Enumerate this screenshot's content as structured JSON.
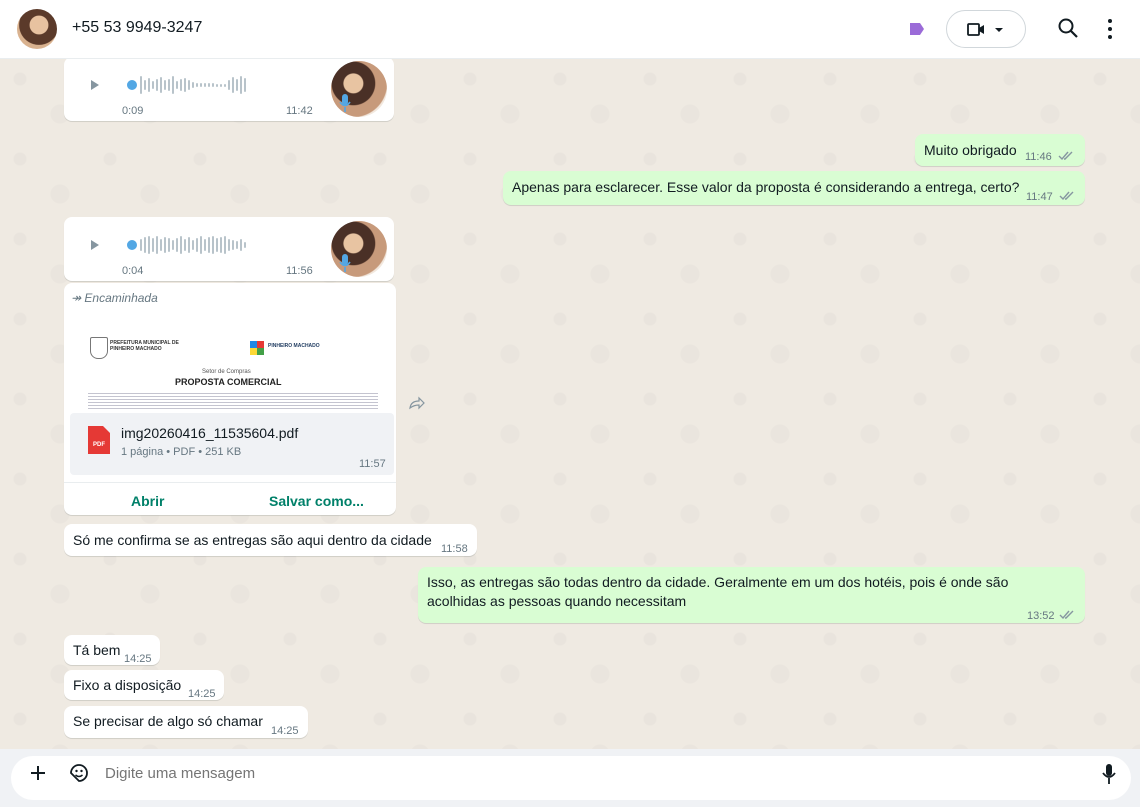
{
  "header": {
    "contact_name": "+55 53 9949-3247",
    "accent": "#8b5cf6"
  },
  "messages": {
    "audio1": {
      "duration": "0:09",
      "time": "11:42"
    },
    "out1": {
      "text": "Muito obrigado",
      "time": "11:46"
    },
    "out2": {
      "text": "Apenas para esclarecer. Esse valor da proposta é considerando a entrega, certo?",
      "time": "11:47"
    },
    "audio2": {
      "duration": "0:04",
      "time": "11:56"
    },
    "document": {
      "forwarded_label": "Encaminhada",
      "preview_org": "PREFEITURA MUNICIPAL DE PINHEIRO MACHADO",
      "preview_logo_text": "PINHEIRO MACHADO",
      "preview_sector": "Setor de Compras",
      "preview_title": "PROPOSTA COMERCIAL",
      "file_name": "img20260416_11535604.pdf",
      "file_meta": "1 página • PDF • 251 KB",
      "icon_label": "PDF",
      "time": "11:57",
      "open_label": "Abrir",
      "save_label": "Salvar como..."
    },
    "in1": {
      "text": "Só me confirma se as entregas são aqui dentro da cidade",
      "time": "11:58"
    },
    "out3": {
      "text": "Isso, as entregas são todas dentro da cidade. Geralmente em um dos hotéis, pois é onde são acolhidas as pessoas quando necessitam",
      "time": "13:52"
    },
    "in2": {
      "text": "Tá bem",
      "time": "14:25"
    },
    "in3": {
      "text": "Fixo a disposição",
      "time": "14:25"
    },
    "in4": {
      "text": "Se precisar de algo só chamar",
      "time": "14:25"
    }
  },
  "composer": {
    "placeholder": "Digite uma mensagem"
  }
}
